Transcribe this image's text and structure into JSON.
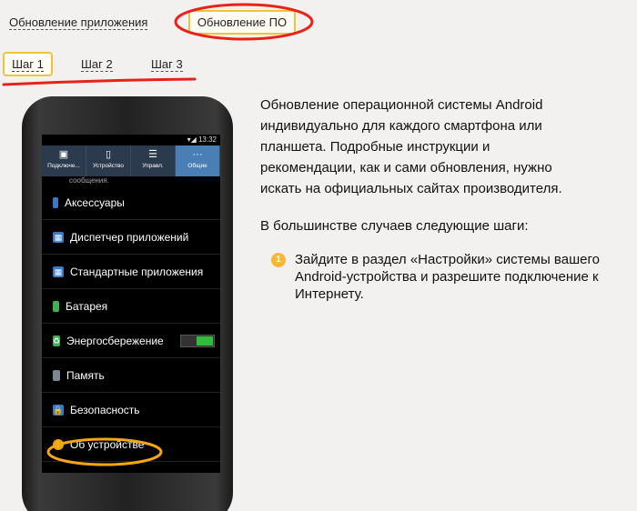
{
  "nav": {
    "tab_app": "Обновление приложения",
    "tab_os": "Обновление ПО"
  },
  "steps": [
    "Шаг 1",
    "Шаг 2",
    "Шаг 3"
  ],
  "phone": {
    "status_time": "13:32",
    "tabs": [
      {
        "label": "Подключе...",
        "icon": "card-icon"
      },
      {
        "label": "Устройство",
        "icon": "phone-icon"
      },
      {
        "label": "Управл.",
        "icon": "sliders-icon"
      },
      {
        "label": "Общие",
        "icon": "dots-icon"
      }
    ],
    "subtext": "сообщения.",
    "items": [
      {
        "label": "Аксессуары",
        "icon": "accessory-icon",
        "color": "#3a78c9"
      },
      {
        "label": "Диспетчер приложений",
        "icon": "grid-icon",
        "color": "#3a78c9"
      },
      {
        "label": "Стандартные приложения",
        "icon": "grid-icon",
        "color": "#3a78c9"
      },
      {
        "label": "Батарея",
        "icon": "battery-icon",
        "color": "#3fb34f"
      },
      {
        "label": "Энергосбережение",
        "icon": "energy-icon",
        "color": "#3fb34f"
      },
      {
        "label": "Память",
        "icon": "memory-icon",
        "color": "#7b8794"
      },
      {
        "label": "Безопасность",
        "icon": "lock-icon",
        "color": "#3a78c9"
      },
      {
        "label": "Об устройстве",
        "icon": "info-icon",
        "color": "#f0a500"
      }
    ]
  },
  "content": {
    "para1": "Обновление операционной системы Android индивидуально для каждого смартфона или планшета. Подробные инструкции и рекомендации, как и сами обновления, нужно искать на официальных сайтах производителя.",
    "para2": "В большинстве случаев следующие шаги:",
    "step_number": "1",
    "step_text": "Зайдите в раздел «Настройки» системы вашего Android-устройства и разрешите подключение к Интернету."
  },
  "colors": {
    "accent_yellow": "#f0c33c",
    "annotation_red": "#e8221b",
    "annotation_orange": "#f5a614"
  }
}
